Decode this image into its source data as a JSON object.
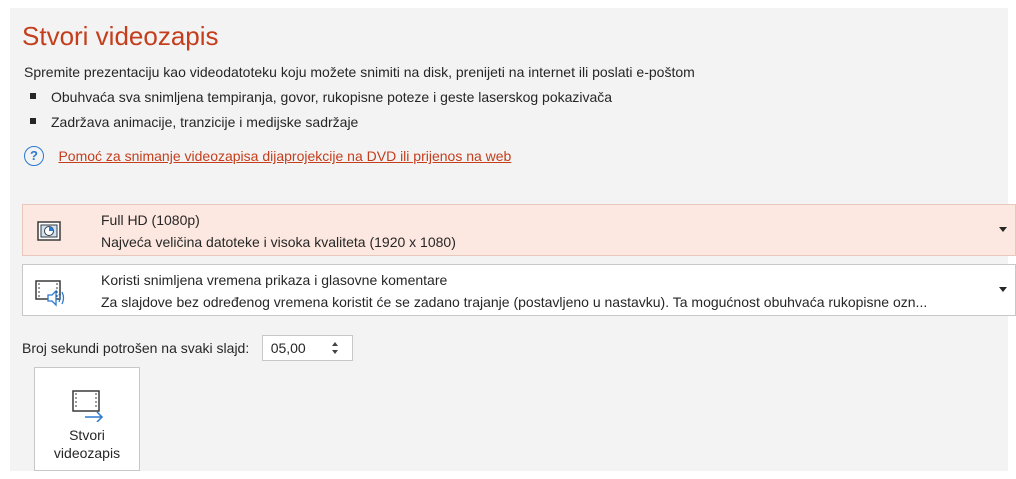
{
  "page": {
    "title": "Stvori videozapis",
    "description": "Spremite prezentaciju kao videodatoteku koju možete snimiti na disk, prenijeti na internet ili poslati e-poštom",
    "bullets": [
      "Obuhvaća sva snimljena tempiranja, govor, rukopisne poteze i geste laserskog pokazivača",
      "Zadržava animacije, tranzicije i medijske sadržaje"
    ],
    "help_icon": "?",
    "help_link": "Pomoć za snimanje videozapisa dijaprojekcije na DVD ili prijenos na web"
  },
  "quality_dropdown": {
    "icon": "monitor-icon",
    "label": "Full HD (1080p)",
    "description": "Najveća veličina datoteke i visoka kvaliteta (1920 x 1080)"
  },
  "timing_dropdown": {
    "icon": "video-narration-icon",
    "label": "Koristi snimljena vremena prikaza i glasovne komentare",
    "description": "Za slajdove bez određenog vremena koristit će se zadano trajanje (postavljeno u nastavku). Ta mogućnost obuhvaća rukopisne ozn..."
  },
  "seconds": {
    "label": "Broj sekundi potrošen na svaki slajd:",
    "value": "05,00"
  },
  "create_button": {
    "icon": "create-video-icon",
    "line1": "Stvori",
    "line2": "videozapis"
  },
  "colors": {
    "accent": "#c43e1c",
    "selected_background": "#fce8e0",
    "help_icon": "#2b79d0",
    "panel_background": "#f3f3f3"
  }
}
